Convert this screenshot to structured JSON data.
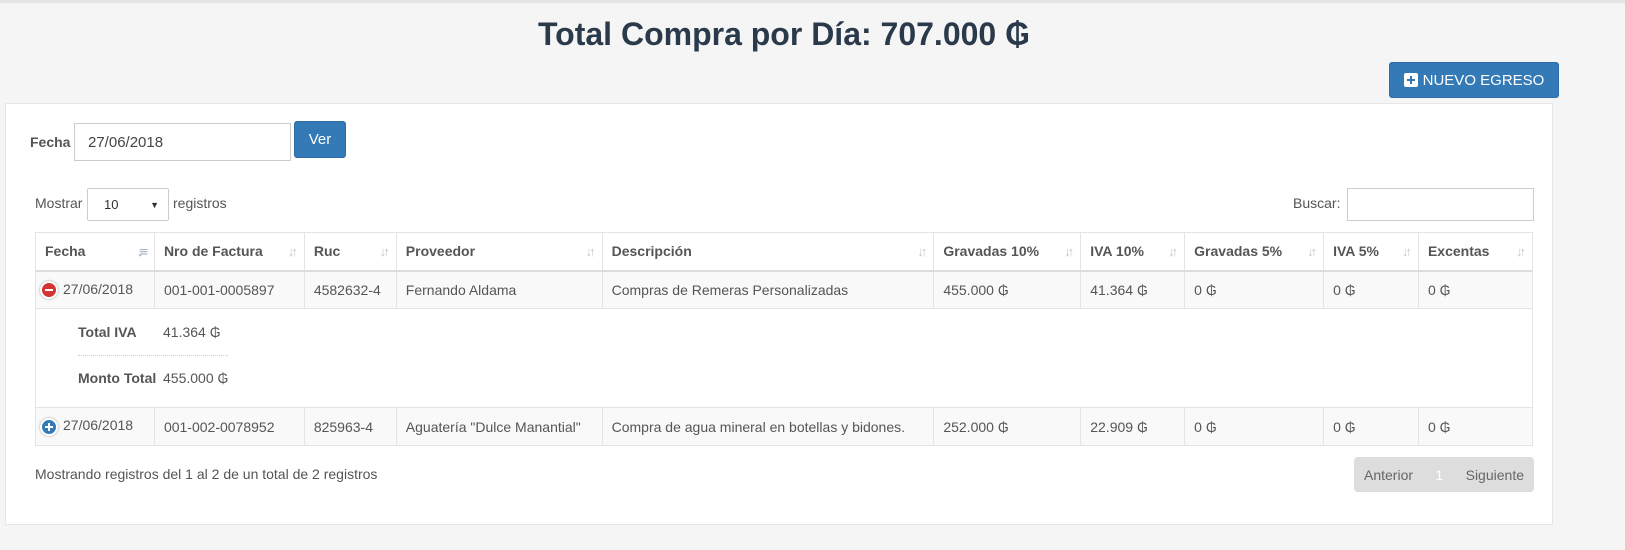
{
  "header": {
    "title": "Total Compra por Día: 707.000 ₲",
    "new_button_label": "NUEVO EGRESO"
  },
  "filter": {
    "date_label": "Fecha",
    "date_value": "27/06/2018",
    "view_button": "Ver"
  },
  "table_controls": {
    "show_label": "Mostrar",
    "page_length": "10",
    "records_label": "registros",
    "search_label": "Buscar:",
    "search_value": ""
  },
  "columns": [
    "Fecha",
    "Nro de Factura",
    "Ruc",
    "Proveedor",
    "Descripción",
    "Gravadas 10%",
    "IVA 10%",
    "Gravadas 5%",
    "IVA 5%",
    "Excentas"
  ],
  "rows": [
    {
      "fecha": "27/06/2018",
      "factura": "001-001-0005897",
      "ruc": "4582632-4",
      "proveedor": "Fernando Aldama",
      "descripcion": "Compras de Remeras Personalizadas",
      "grav10": "455.000 ₲",
      "iva10": "41.364 ₲",
      "grav5": "0 ₲",
      "iva5": "0 ₲",
      "excentas": "0 ₲",
      "expanded": true
    },
    {
      "fecha": "27/06/2018",
      "factura": "001-002-0078952",
      "ruc": "825963-4",
      "proveedor": "Aguatería \"Dulce Manantial\"",
      "descripcion": "Compra de agua mineral en botellas y bidones.",
      "grav10": "252.000 ₲",
      "iva10": "22.909 ₲",
      "grav5": "0 ₲",
      "iva5": "0 ₲",
      "excentas": "0 ₲",
      "expanded": false
    }
  ],
  "detail": {
    "total_iva_label": "Total IVA",
    "total_iva_value": "41.364 ₲",
    "monto_total_label": "Monto Total",
    "monto_total_value": "455.000 ₲"
  },
  "footer": {
    "info": "Mostrando registros del 1 al 2 de un total de 2 registros",
    "prev": "Anterior",
    "page": "1",
    "next": "Siguiente"
  },
  "colors": {
    "primary": "#337ab7",
    "danger": "#d33333",
    "title": "#2a3a4b"
  }
}
